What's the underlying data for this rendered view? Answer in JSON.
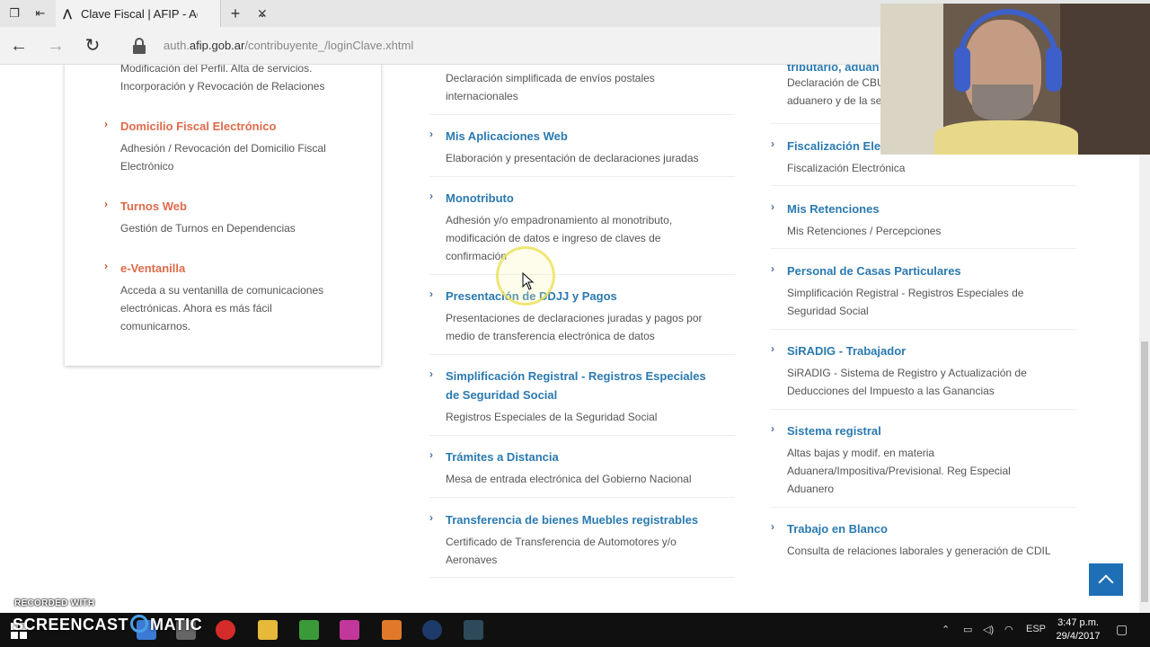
{
  "browser": {
    "tab_title": "Clave Fiscal | AFIP - Adm",
    "url_domain_prefix": "auth.",
    "url_domain": "afip.gob.ar",
    "url_path": "/contribuyente_/loginClave.xhtml"
  },
  "left_card": [
    {
      "title": "",
      "desc": "Modificación del Perfil. Alta de servicios. Incorporación y Revocación de Relaciones"
    },
    {
      "title": "Domicilio Fiscal Electrónico",
      "desc": "Adhesión / Revocación del Domicilio Fiscal Electrónico"
    },
    {
      "title": "Turnos Web",
      "desc": "Gestión de Turnos en Dependencias"
    },
    {
      "title": "e-Ventanilla",
      "desc": "Acceda a su ventanilla de comunicaciones electrónicas. Ahora es más fácil comunicarnos."
    }
  ],
  "middle_column": [
    {
      "title": "",
      "desc": "Declaración simplificada de envíos postales internacionales"
    },
    {
      "title": "Mis Aplicaciones Web",
      "desc": "Elaboración y presentación de declaraciones juradas"
    },
    {
      "title": "Monotributo",
      "desc": "Adhesión y/o empadronamiento al monotributo, modificación de datos e ingreso de claves de confirmación"
    },
    {
      "title": "Presentación de DDJJ y Pagos",
      "desc": "Presentaciones de declaraciones juradas y pagos por medio de transferencia electrónica de datos"
    },
    {
      "title": "Simplificación Registral - Registros Especiales de Seguridad Social",
      "desc": "Registros Especiales de la Seguridad Social"
    },
    {
      "title": "Trámites a Distancia",
      "desc": "Mesa de entrada electrónica del Gobierno Nacional"
    },
    {
      "title": "Transferencia de bienes Muebles registrables",
      "desc": "Certificado de Transferencia de Automotores y/o Aeronaves"
    }
  ],
  "right_column": [
    {
      "title": "tributario, aduan",
      "desc": "Declaración de CBU aduanero y de la se"
    },
    {
      "title": "Fiscalización Ele",
      "desc": "Fiscalización Electrónica"
    },
    {
      "title": "Mis Retenciones",
      "desc": "Mis Retenciones / Percepciones"
    },
    {
      "title": "Personal de Casas Particulares",
      "desc": "Simplificación Registral - Registros Especiales de Seguridad Social"
    },
    {
      "title": "SiRADIG - Trabajador",
      "desc": "SiRADIG - Sistema de Registro y Actualización de Deducciones del Impuesto a las Ganancias"
    },
    {
      "title": "Sistema registral",
      "desc": "Altas bajas y modif. en materia Aduanera/Impositiva/Previsional. Reg Especial Aduanero"
    },
    {
      "title": "Trabajo en Blanco",
      "desc": "Consulta de relaciones laborales y generación de CDIL"
    }
  ],
  "watermark": {
    "small": "RECORDED WITH",
    "big_left": "SCREENCAST",
    "big_right": "MATIC"
  },
  "taskbar": {
    "lang": "ESP",
    "time": "3:47 p.m.",
    "date": "29/4/2017"
  },
  "icons": [
    "tab-actions-icon",
    "set-aside-tabs-icon",
    "afip-favicon",
    "close-tab-icon",
    "new-tab-icon",
    "tab-list-icon",
    "back-icon",
    "forward-icon",
    "refresh-icon",
    "lock-icon",
    "chevron-right-icon",
    "scroll-to-top-icon",
    "windows-start-icon"
  ]
}
